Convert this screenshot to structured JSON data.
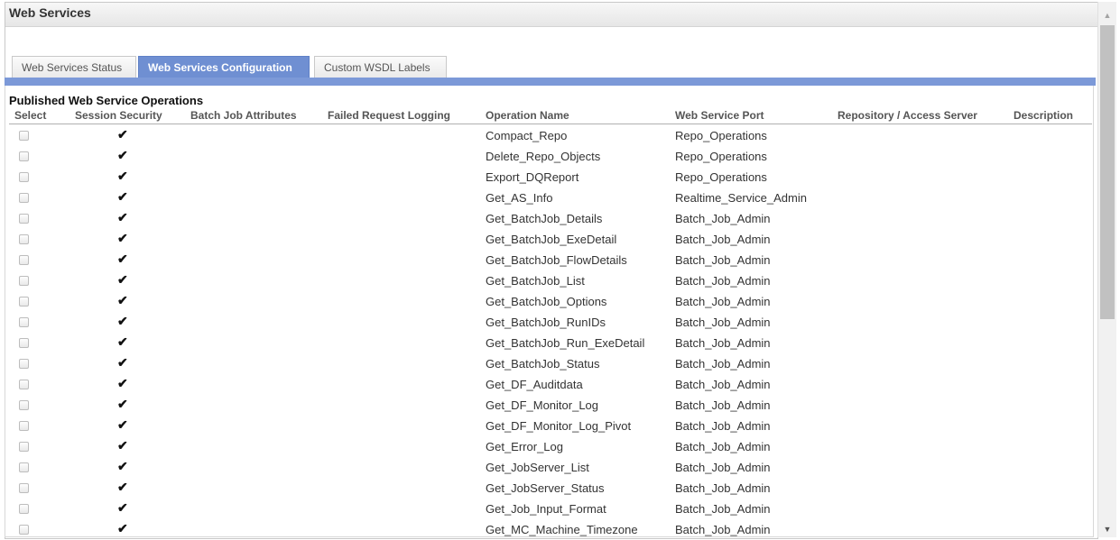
{
  "window": {
    "title": "Web Services"
  },
  "tabs": [
    {
      "label": "Web Services Status",
      "active": false
    },
    {
      "label": "Web Services Configuration",
      "active": true
    },
    {
      "label": "Custom WSDL Labels",
      "active": false
    }
  ],
  "section": {
    "title": "Published Web Service Operations"
  },
  "columns": {
    "select": "Select",
    "session_security": "Session Security",
    "batch_job_attributes": "Batch Job Attributes",
    "failed_request_logging": "Failed Request Logging",
    "operation_name": "Operation Name",
    "web_service_port": "Web Service Port",
    "repository": "Repository / Access Server",
    "description": "Description"
  },
  "rows": [
    {
      "operation": "Compact_Repo",
      "port": "Repo_Operations",
      "selected": false,
      "session_security": true
    },
    {
      "operation": "Delete_Repo_Objects",
      "port": "Repo_Operations",
      "selected": false,
      "session_security": true
    },
    {
      "operation": "Export_DQReport",
      "port": "Repo_Operations",
      "selected": false,
      "session_security": true
    },
    {
      "operation": "Get_AS_Info",
      "port": "Realtime_Service_Admin",
      "selected": false,
      "session_security": true
    },
    {
      "operation": "Get_BatchJob_Details",
      "port": "Batch_Job_Admin",
      "selected": false,
      "session_security": true
    },
    {
      "operation": "Get_BatchJob_ExeDetail",
      "port": "Batch_Job_Admin",
      "selected": false,
      "session_security": true
    },
    {
      "operation": "Get_BatchJob_FlowDetails",
      "port": "Batch_Job_Admin",
      "selected": false,
      "session_security": true
    },
    {
      "operation": "Get_BatchJob_List",
      "port": "Batch_Job_Admin",
      "selected": false,
      "session_security": true
    },
    {
      "operation": "Get_BatchJob_Options",
      "port": "Batch_Job_Admin",
      "selected": false,
      "session_security": true
    },
    {
      "operation": "Get_BatchJob_RunIDs",
      "port": "Batch_Job_Admin",
      "selected": false,
      "session_security": true
    },
    {
      "operation": "Get_BatchJob_Run_ExeDetail",
      "port": "Batch_Job_Admin",
      "selected": false,
      "session_security": true
    },
    {
      "operation": "Get_BatchJob_Status",
      "port": "Batch_Job_Admin",
      "selected": false,
      "session_security": true
    },
    {
      "operation": "Get_DF_Auditdata",
      "port": "Batch_Job_Admin",
      "selected": false,
      "session_security": true
    },
    {
      "operation": "Get_DF_Monitor_Log",
      "port": "Batch_Job_Admin",
      "selected": false,
      "session_security": true
    },
    {
      "operation": "Get_DF_Monitor_Log_Pivot",
      "port": "Batch_Job_Admin",
      "selected": false,
      "session_security": true
    },
    {
      "operation": "Get_Error_Log",
      "port": "Batch_Job_Admin",
      "selected": false,
      "session_security": true
    },
    {
      "operation": "Get_JobServer_List",
      "port": "Batch_Job_Admin",
      "selected": false,
      "session_security": true
    },
    {
      "operation": "Get_JobServer_Status",
      "port": "Batch_Job_Admin",
      "selected": false,
      "session_security": true
    },
    {
      "operation": "Get_Job_Input_Format",
      "port": "Batch_Job_Admin",
      "selected": false,
      "session_security": true
    },
    {
      "operation": "Get_MC_Machine_Timezone",
      "port": "Batch_Job_Admin",
      "selected": false,
      "session_security": true
    }
  ],
  "icons": {
    "check": "checkmark-icon",
    "scroll_up": "arrow-up-icon",
    "scroll_down": "arrow-down-icon"
  },
  "colors": {
    "tab_active": "#6f8fd2",
    "band": "#7c99d8"
  }
}
